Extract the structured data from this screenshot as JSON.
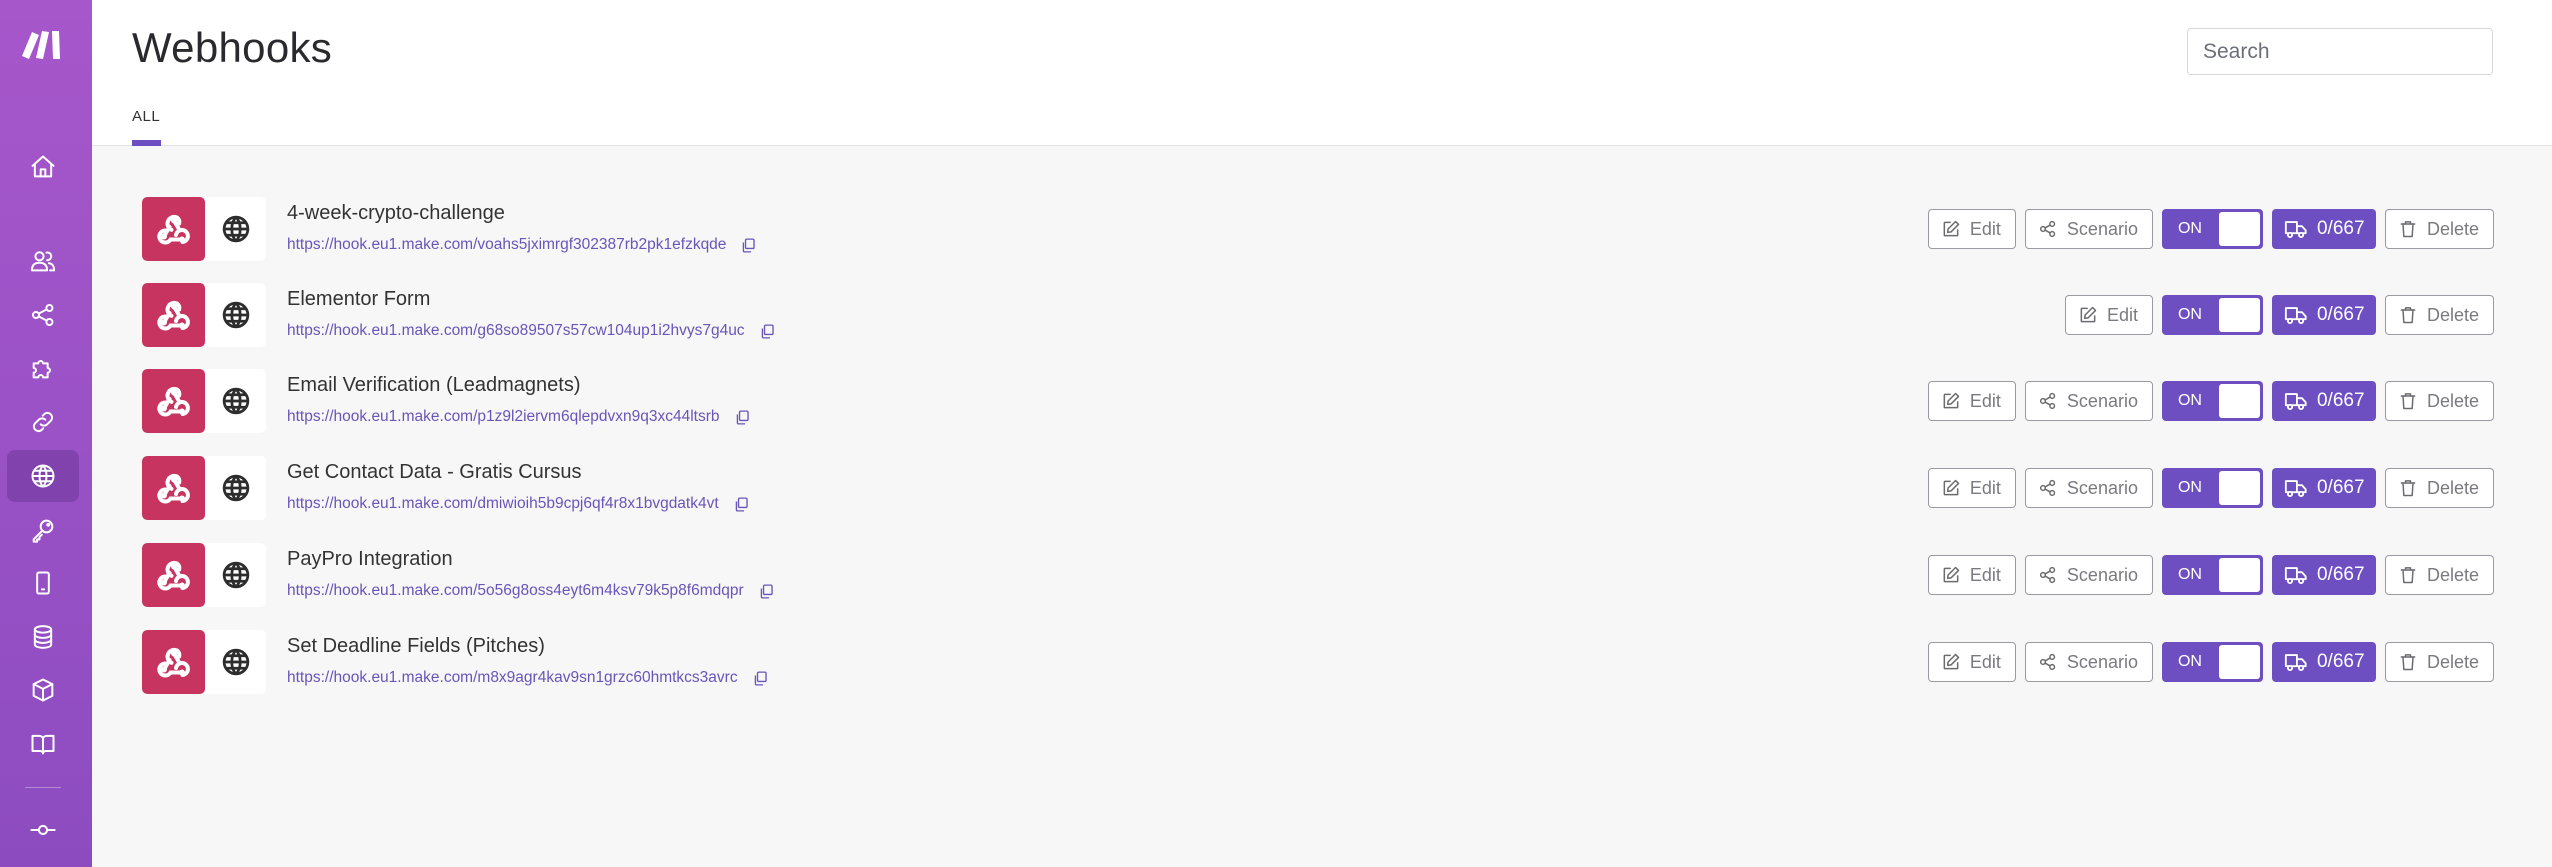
{
  "app": {
    "brand_color": "#6d4fc2",
    "sidebar_color": "#a056c8",
    "hook_tile_color": "#c7345f"
  },
  "sidebar": {
    "logo": "make-logo-icon",
    "items": [
      {
        "icon": "home-icon",
        "label": "Home",
        "active": false
      },
      {
        "icon": "users-icon",
        "label": "Team",
        "active": false
      },
      {
        "icon": "share-icon",
        "label": "Scenarios",
        "active": false
      },
      {
        "icon": "puzzle-icon",
        "label": "Templates",
        "active": false
      },
      {
        "icon": "link-icon",
        "label": "Connections",
        "active": false
      },
      {
        "icon": "globe-icon",
        "label": "Webhooks",
        "active": true
      },
      {
        "icon": "key-icon",
        "label": "Keys",
        "active": false
      },
      {
        "icon": "mobile-icon",
        "label": "Devices",
        "active": false
      },
      {
        "icon": "database-icon",
        "label": "Data stores",
        "active": false
      },
      {
        "icon": "cube-icon",
        "label": "Data structures",
        "active": false
      },
      {
        "icon": "book-icon",
        "label": "Custom apps",
        "active": false
      },
      {
        "icon": "commit-icon",
        "label": "More",
        "active": false
      }
    ]
  },
  "header": {
    "title": "Webhooks",
    "tabs": [
      {
        "label": "ALL",
        "active": true
      }
    ],
    "search": {
      "placeholder": "Search",
      "value": ""
    }
  },
  "webhooks": [
    {
      "name": "4-week-crypto-challenge",
      "url": "https://hook.eu1.make.com/voahs5jximrgf302387rb2pk1efzkqde",
      "has_scenario": true,
      "status": "ON",
      "count": "0/667"
    },
    {
      "name": "Elementor Form",
      "url": "https://hook.eu1.make.com/g68so89507s57cw104up1i2hvys7g4uc",
      "has_scenario": false,
      "status": "ON",
      "count": "0/667"
    },
    {
      "name": "Email Verification (Leadmagnets)",
      "url": "https://hook.eu1.make.com/p1z9l2iervm6qlepdvxn9q3xc44ltsrb",
      "has_scenario": true,
      "status": "ON",
      "count": "0/667"
    },
    {
      "name": "Get Contact Data - Gratis Cursus",
      "url": "https://hook.eu1.make.com/dmiwioih5b9cpj6qf4r8x1bvgdatk4vt",
      "has_scenario": true,
      "status": "ON",
      "count": "0/667"
    },
    {
      "name": "PayPro Integration",
      "url": "https://hook.eu1.make.com/5o56g8oss4eyt6m4ksv79k5p8f6mdqpr",
      "has_scenario": true,
      "status": "ON",
      "count": "0/667"
    },
    {
      "name": "Set Deadline Fields (Pitches)",
      "url": "https://hook.eu1.make.com/m8x9agr4kav9sn1grzc60hmtkcs3avrc",
      "has_scenario": true,
      "status": "ON",
      "count": "0/667"
    }
  ],
  "actions": {
    "edit_label": "Edit",
    "scenario_label": "Scenario",
    "delete_label": "Delete"
  }
}
